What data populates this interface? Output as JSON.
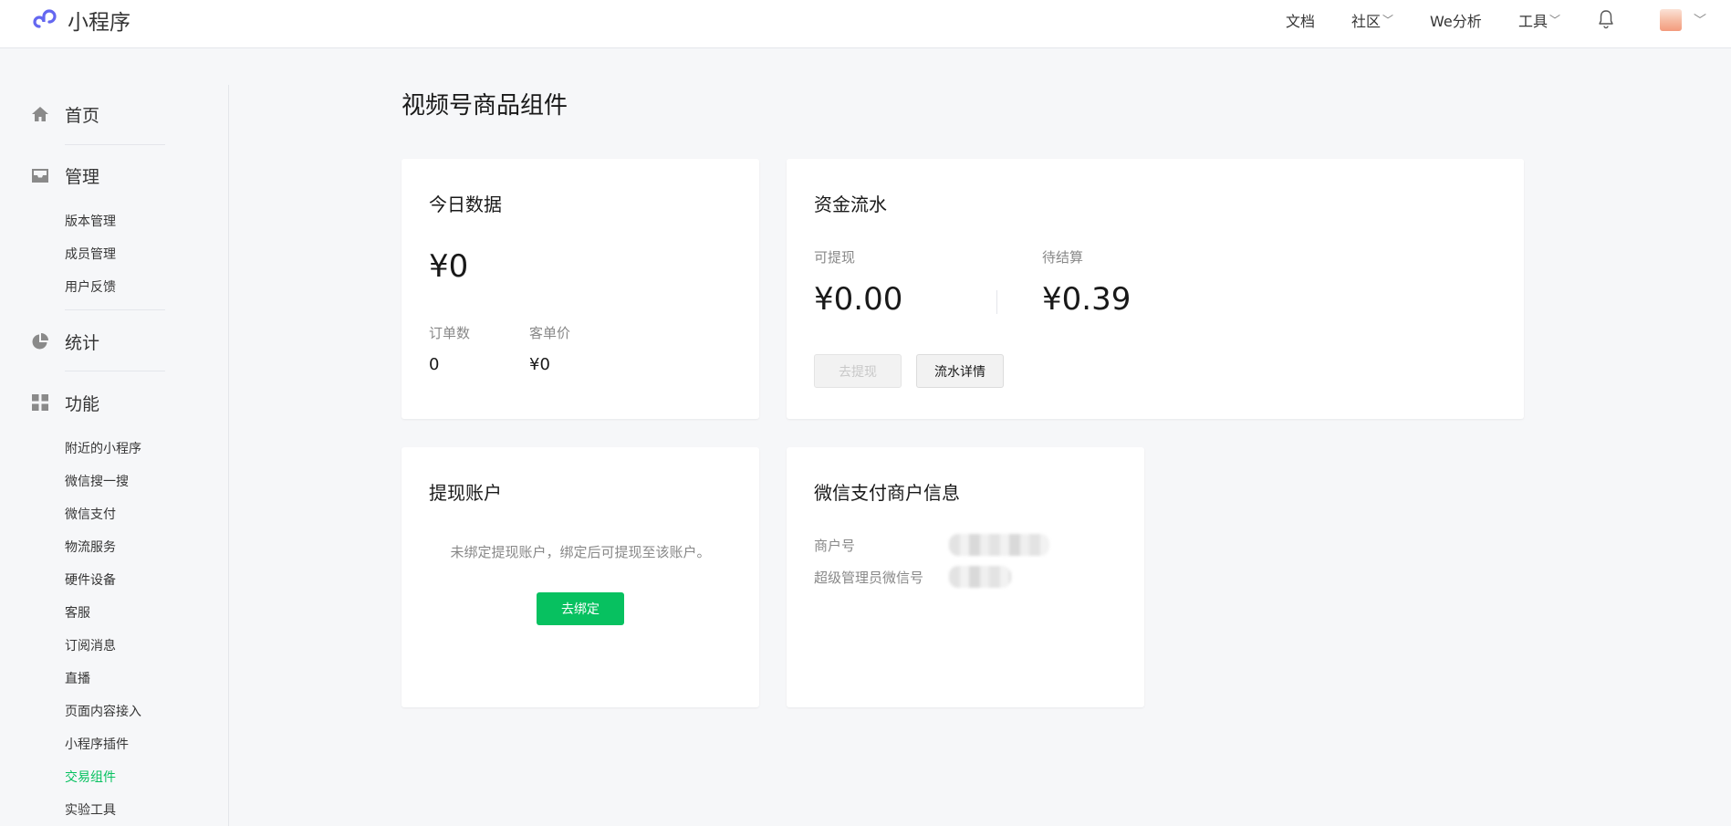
{
  "header": {
    "app_name": "小程序",
    "nav": [
      {
        "label": "文档",
        "has_dropdown": false
      },
      {
        "label": "社区",
        "has_dropdown": true
      },
      {
        "label": "We分析",
        "has_dropdown": false
      },
      {
        "label": "工具",
        "has_dropdown": true
      }
    ],
    "icons": {
      "logo": "mini-program-logo",
      "notification": "bell-icon",
      "avatar": "user-avatar",
      "dropdown": "chevron-down-icon"
    },
    "chevron": "﹀"
  },
  "sidebar": {
    "home": {
      "label": "首页",
      "icon": "home-icon"
    },
    "manage": {
      "label": "管理",
      "icon": "inbox-icon",
      "items": [
        "版本管理",
        "成员管理",
        "用户反馈"
      ]
    },
    "stats": {
      "label": "统计",
      "icon": "pie-chart-icon"
    },
    "features": {
      "label": "功能",
      "icon": "grid-icon",
      "items": [
        "附近的小程序",
        "微信搜一搜",
        "微信支付",
        "物流服务",
        "硬件设备",
        "客服",
        "订阅消息",
        "直播",
        "页面内容接入",
        "小程序插件",
        "交易组件",
        "实验工具"
      ],
      "active_item": "交易组件"
    }
  },
  "page": {
    "title": "视频号商品组件",
    "today": {
      "title": "今日数据",
      "amount": "¥0",
      "orders_label": "订单数",
      "orders_value": "0",
      "avg_price_label": "客单价",
      "avg_price_value": "¥0"
    },
    "funds": {
      "title": "资金流水",
      "withdrawable_label": "可提现",
      "withdrawable_value": "¥0.00",
      "pending_label": "待结算",
      "pending_value": "¥0.39",
      "withdraw_button": "去提现",
      "details_button": "流水详情"
    },
    "account": {
      "title": "提现账户",
      "message": "未绑定提现账户，绑定后可提现至该账户。",
      "bind_button": "去绑定"
    },
    "merchant": {
      "title": "微信支付商户信息",
      "merchant_id_label": "商户号",
      "admin_wechat_label": "超级管理员微信号"
    }
  },
  "colors": {
    "accent": "#07c160",
    "background": "#f6f7f9",
    "card": "#ffffff",
    "text_muted": "#888888"
  }
}
